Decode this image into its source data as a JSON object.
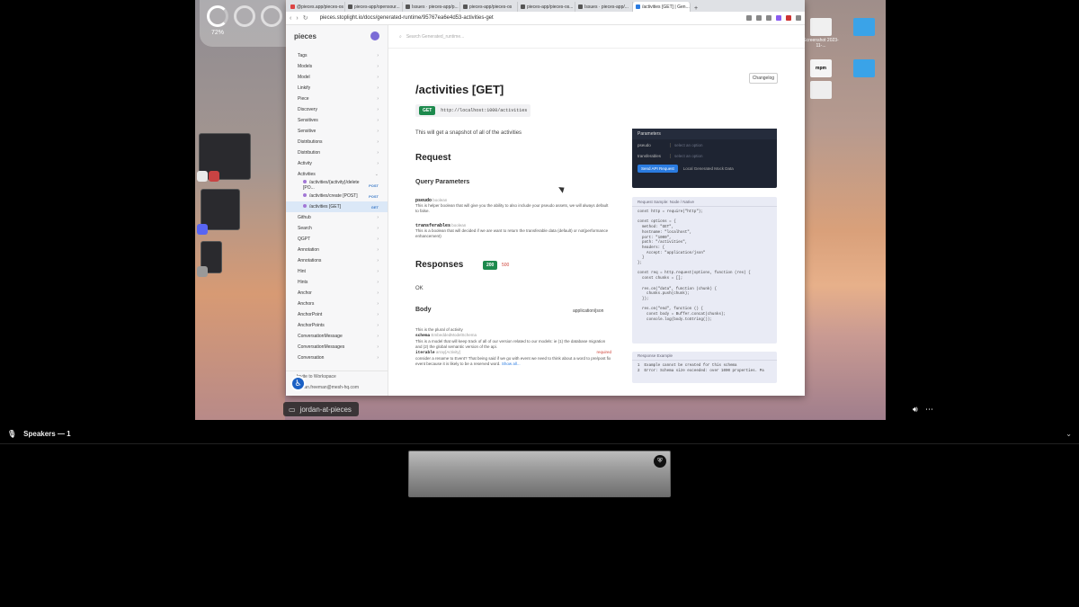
{
  "browser": {
    "tabs": [
      {
        "label": "@pieces.app/pieces-os"
      },
      {
        "label": "pieces-app/opensour..."
      },
      {
        "label": "Issues · pieces-app/p..."
      },
      {
        "label": "pieces-app/pieces-os"
      },
      {
        "label": "pieces-app/pieces-os..."
      },
      {
        "label": "Issues · pieces-app/..."
      },
      {
        "label": "/activities [GET] | Gen..."
      }
    ],
    "url": "pieces.stoplight.io/docs/generated-runtime/95767ea6e4d53-activities-get"
  },
  "sidebar": {
    "brand": "pieces",
    "items": [
      {
        "label": "Tags"
      },
      {
        "label": "Models"
      },
      {
        "label": "Model"
      },
      {
        "label": "Linkify"
      },
      {
        "label": "Piece"
      },
      {
        "label": "Discovery"
      },
      {
        "label": "Sensitives"
      },
      {
        "label": "Sensitive"
      },
      {
        "label": "Distributions"
      },
      {
        "label": "Distribution"
      },
      {
        "label": "Activity"
      },
      {
        "label": "Activities"
      }
    ],
    "subitems": [
      {
        "label": "/activities/{activity}/delete [PO...",
        "method": "POST"
      },
      {
        "label": "/activities/create [POST]",
        "method": "POST"
      },
      {
        "label": "/activities [GET]",
        "method": "GET"
      }
    ],
    "items2": [
      {
        "label": "Github"
      },
      {
        "label": "Search"
      },
      {
        "label": "QGPT"
      },
      {
        "label": "Annotation"
      },
      {
        "label": "Annotations"
      },
      {
        "label": "Hint"
      },
      {
        "label": "Hints"
      },
      {
        "label": "Anchor"
      },
      {
        "label": "Anchors"
      },
      {
        "label": "AnchorPoint"
      },
      {
        "label": "AnchorPoints"
      },
      {
        "label": "ConversationMessage"
      },
      {
        "label": "ConversationMessages"
      },
      {
        "label": "Conversation"
      }
    ],
    "invite": "Invite to Workspace",
    "user": "jordan.freeman@mesh-hq.com"
  },
  "main": {
    "search_placeholder": "Search Generated_runtime...",
    "changelog": "Changelog",
    "title": "/activities [GET]",
    "method": "GET",
    "endpoint": "http://localhost:1000/activities",
    "description": "This will get a snapshot of all of the activities",
    "request_heading": "Request",
    "query_heading": "Query Parameters",
    "params": [
      {
        "name": "pseudo",
        "type": "boolean",
        "desc": "This is helper boolean that will give you the ability to also include your pseudo assets, we will always default to false."
      },
      {
        "name": "transferables",
        "type": "boolean",
        "desc": "This is a boolean that will decided if we are want to return the transferable data (default) or not(performance enhancement)"
      }
    ],
    "responses_heading": "Responses",
    "code_200": "200",
    "code_500": "500",
    "ok": "OK",
    "body_heading": "Body",
    "mime": "application/json",
    "body_desc": "This is the plural of activity",
    "schema_name": "schema",
    "schema_type": "EmbeddedModelSchema",
    "schema_desc": "This is a model that will keep track of all of our version related to our models: ie (1) the database migration and (2) the global semantic version of the api.",
    "iterable_name": "iterable",
    "iterable_type": "array[Activity]",
    "iterable_req": "required",
    "iterable_desc": "consider a rename to Event? That being said if we go with event we need to think about a word to pre/post fix event because it is likely to be a reserved word.",
    "show_all": "Show all..."
  },
  "panel": {
    "params_header": "Parameters",
    "pseudo_label": "pseudo",
    "pseudo_value": "select an option",
    "transferables_label": "transferables",
    "transferables_value": "select an option",
    "send_button": "Send API Request",
    "mock_label": "Local Generated Mock Data",
    "sample_header": "Request Sample: Node / Native",
    "sample_code": "const http = require(\"http\");\n\nconst options = {\n  method: \"GET\",\n  hostname: \"localhost\",\n  port: \"1000\",\n  path: \"/activities\",\n  headers: {\n    Accept: \"application/json\"\n  }\n};\n\nconst req = http.request(options, function (res) {\n  const chunks = [];\n\n  res.on(\"data\", function (chunk) {\n    chunks.push(chunk);\n  });\n\n  res.on(\"end\", function () {\n    const body = Buffer.concat(chunks);\n    console.log(body.toString());",
    "response_header": "Response Example",
    "response_code": "1  Example cannot be created for this schema\n2  Error: Schema size exceeded: over 1000 properties. Pa"
  },
  "desktop": {
    "battery_pct": "72%",
    "share_label": "jordan-at-pieces",
    "icons": [
      {
        "label": "Screenshot 2023-11-..."
      },
      {
        "label": "mpm"
      },
      {
        "label": "Screenshot 2023-11..."
      }
    ]
  },
  "call": {
    "speakers": "Speakers — 1"
  },
  "colors": {
    "get_green": "#1d8a4d",
    "error_red": "#d0453b",
    "accent_blue": "#2a7be0",
    "panel_dark": "#1e2432"
  }
}
